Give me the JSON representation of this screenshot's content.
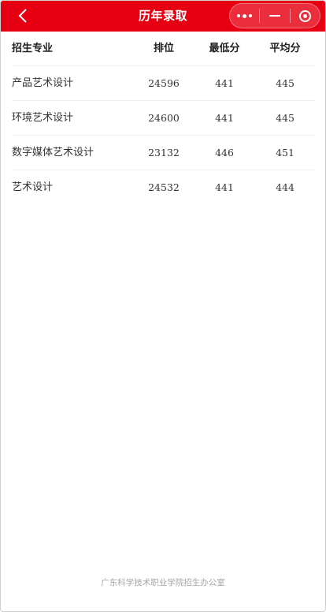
{
  "navbar": {
    "title": "历年录取",
    "background": "#e60012"
  },
  "table": {
    "headers": {
      "major": "招生专业",
      "rank": "排位",
      "min": "最低分",
      "avg": "平均分"
    },
    "rows": [
      {
        "major": "产品艺术设计",
        "rank": "24596",
        "min": "441",
        "avg": "445"
      },
      {
        "major": "环境艺术设计",
        "rank": "24600",
        "min": "441",
        "avg": "445"
      },
      {
        "major": "数字媒体艺术设计",
        "rank": "23132",
        "min": "446",
        "avg": "451"
      },
      {
        "major": "艺术设计",
        "rank": "24532",
        "min": "441",
        "avg": "444"
      }
    ]
  },
  "footer": {
    "text": "广东科学技术职业学院招生办公室"
  },
  "icons": {
    "back": "chevron-left-icon",
    "more": "more-dots-icon",
    "minimize": "minus-icon",
    "close": "target-circle-icon"
  }
}
